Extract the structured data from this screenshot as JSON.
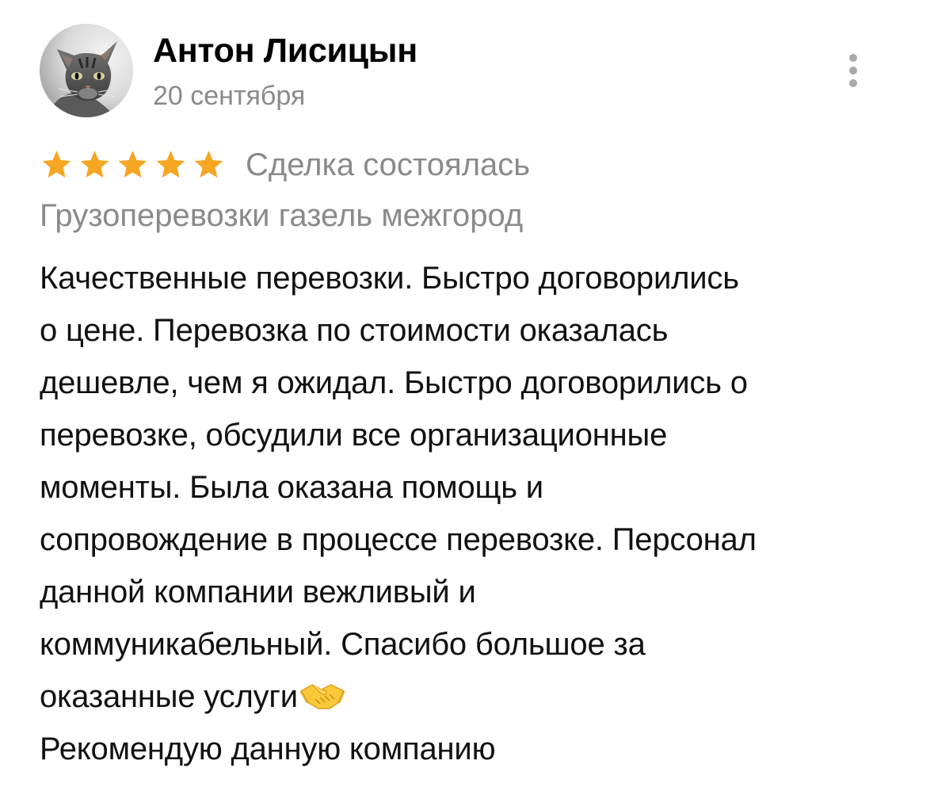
{
  "review": {
    "author_name": "Антон Лисицын",
    "date": "20 сентября",
    "avatar_icon": "cat-photo-avatar",
    "more_icon": "vertical-ellipsis-icon",
    "rating": 5,
    "rating_max": 5,
    "star_color": "#F5A623",
    "deal_status": "Сделка состоялась",
    "service": "Грузоперевозки газель межгород",
    "text_lines": [
      "Качественные перевозки. Быстро договорились",
      "о цене. Перевозка по стоимости оказалась",
      "дешевле, чем я ожидал. Быстро договорились о",
      "перевозке, обсудили все организационные",
      "моменты. Была оказана помощь и",
      "сопровождение в процессе перевозке. Персонал",
      "данной компании вежливый и",
      "коммуникабельный. Спасибо большое за",
      "оказанные услуги",
      "Рекомендую данную компанию"
    ],
    "emoji": "handshake-icon"
  },
  "colors": {
    "secondary_text": "#8A8A8A",
    "menu_dots": "#A9A9A9"
  }
}
